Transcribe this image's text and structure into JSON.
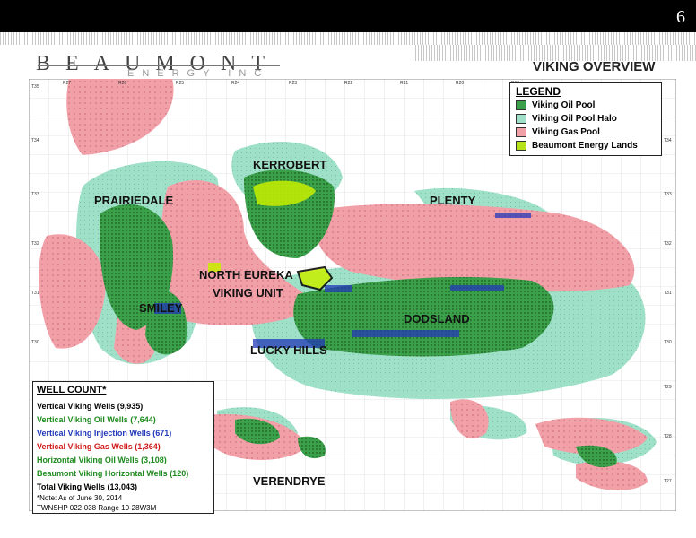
{
  "header": {
    "page_number": "6",
    "bar_color": "#000000"
  },
  "logo": {
    "main": "BEAUMONT",
    "sub": "ENERGY INC"
  },
  "title": "VIKING OVERVIEW",
  "legend": {
    "title": "LEGEND",
    "items": [
      {
        "label": "Viking Oil Pool",
        "color": "#3aa04a"
      },
      {
        "label": "Viking Oil Pool Halo",
        "color": "#9fe0c8"
      },
      {
        "label": "Viking Gas Pool",
        "color": "#f2a0a8"
      },
      {
        "label": "Beaumont Energy Lands",
        "color": "#b6e21a"
      }
    ]
  },
  "map": {
    "labels": [
      "KERROBERT",
      "PRAIRIEDALE",
      "PLENTY",
      "NORTH EUREKA",
      "VIKING UNIT",
      "SMILEY",
      "DODSLAND",
      "LUCKY HILLS",
      "VERENDRYE"
    ],
    "range_labels": [
      "R27",
      "R26",
      "R25",
      "R24",
      "R23",
      "R22",
      "R21",
      "R20",
      "R19"
    ],
    "township_labels": [
      "T35",
      "T34",
      "T33",
      "T32",
      "T31",
      "T30",
      "T29",
      "T28",
      "T27"
    ],
    "colors": {
      "oil": "#3aa04a",
      "halo": "#9fe0c8",
      "gas": "#f2a0a8",
      "lands": "#c8f000",
      "injection": "#2238b8",
      "grid": "#d0d0d0"
    }
  },
  "well_count": {
    "title": "WELL COUNT*",
    "rows": [
      {
        "text": "Vertical Viking Wells (9,935)",
        "color": "#000000"
      },
      {
        "text": "Vertical Viking Oil Wells (7,644)",
        "color": "#1d8a1d"
      },
      {
        "text": "Vertical Viking Injection Wells (671)",
        "color": "#2238b8"
      },
      {
        "text": "Vertical Viking Gas Wells (1,364)",
        "color": "#d01818"
      },
      {
        "text": "Horizontal Viking Oil Wells (3,108)",
        "color": "#1d8a1d"
      },
      {
        "text": "Beaumont Viking Horizontal Wells (120)",
        "color": "#1d8a1d"
      },
      {
        "text": "Total Viking Wells (13,043)",
        "color": "#000000"
      }
    ],
    "note": "*Note: As of June 30, 2014",
    "township": "TWNSHP 022-038 Range 10-28W3M"
  }
}
